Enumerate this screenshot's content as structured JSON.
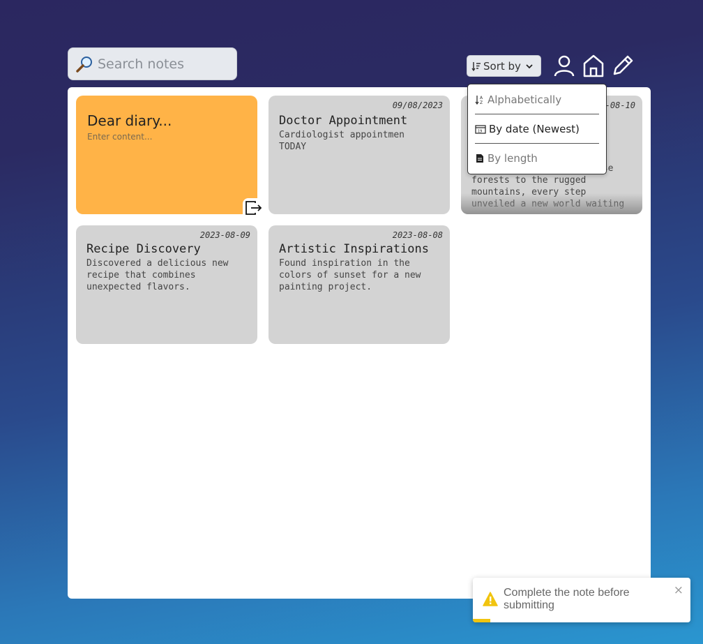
{
  "search": {
    "placeholder": "Search notes"
  },
  "sort": {
    "label": "Sort by",
    "options": [
      {
        "label": "Alphabetically",
        "selected": false
      },
      {
        "label": "By date (Newest)",
        "selected": true
      },
      {
        "label": "By length",
        "selected": false
      }
    ]
  },
  "nav": {
    "icons": [
      "user-icon",
      "home-icon",
      "pencil-icon"
    ]
  },
  "draft": {
    "title": "Dear diary...",
    "content_placeholder": "Enter content..."
  },
  "notes": [
    {
      "date": "09/08/2023",
      "title": "Doctor Appointment",
      "content": "Cardiologist appointmen TODAY"
    },
    {
      "date": "2023-08-10",
      "title": "",
      "content": "landscapes. From the dense forests to the rugged mountains, every step unveiled a new world waiting"
    },
    {
      "date": "2023-08-09",
      "title": "Recipe Discovery",
      "content": "Discovered a delicious new recipe that combines unexpected flavors."
    },
    {
      "date": "2023-08-08",
      "title": "Artistic Inspirations",
      "content": "Found inspiration in the colors of sunset for a new painting project."
    }
  ],
  "toast": {
    "message": "Complete the note before submitting",
    "close": "×",
    "progress": 0.08
  },
  "colors": {
    "draft": "#ffb347",
    "note": "#d3d3d3",
    "warning": "#f1c40f"
  }
}
